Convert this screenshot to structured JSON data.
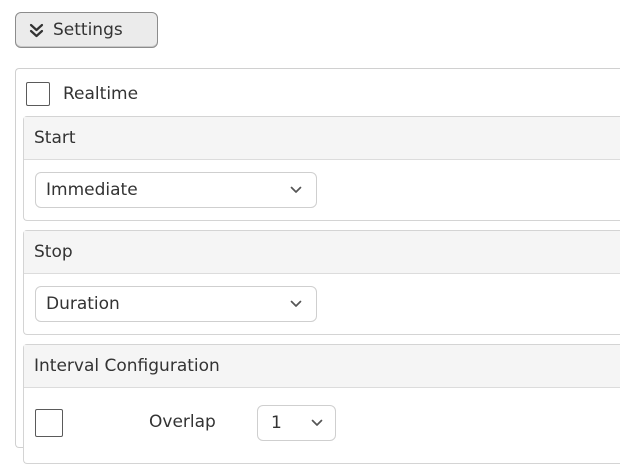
{
  "settings_button": {
    "label": "Settings",
    "icon": "double-chevron-down-icon"
  },
  "realtime": {
    "label": "Realtime",
    "checked": false
  },
  "start": {
    "heading": "Start",
    "selected": "Immediate"
  },
  "stop": {
    "heading": "Stop",
    "selected": "Duration"
  },
  "interval_configuration": {
    "heading": "Interval Configuration",
    "overlap_label": "Overlap",
    "overlap_checked": false,
    "overlap_value": "1"
  },
  "colors": {
    "button_background": "#ebebeb",
    "heading_background": "#f5f5f5",
    "border": "#d0d0d0",
    "text": "#333333"
  }
}
